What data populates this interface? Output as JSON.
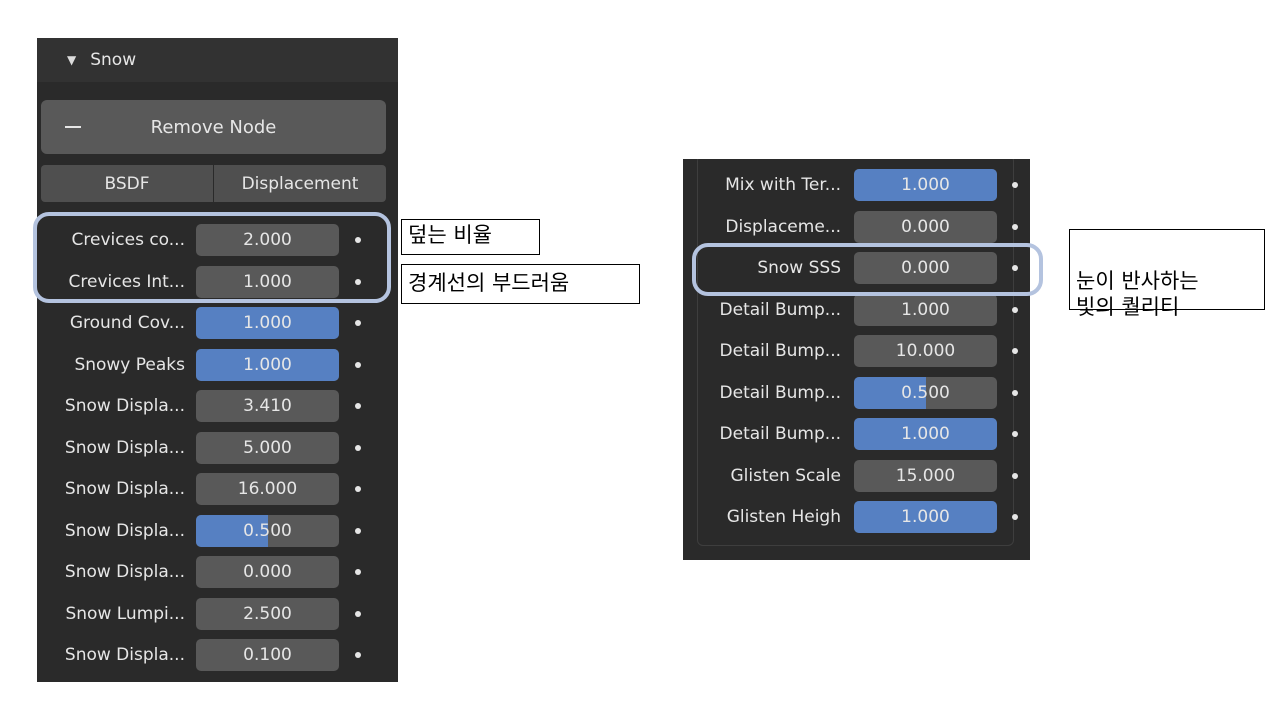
{
  "left_panel": {
    "header": {
      "title": "Snow"
    },
    "remove_button": {
      "label": "Remove Node"
    },
    "tabs": [
      {
        "label": "BSDF"
      },
      {
        "label": "Displacement"
      }
    ],
    "rows": [
      {
        "label": "Crevices co...",
        "value": "2.000",
        "fill": 0
      },
      {
        "label": "Crevices Int...",
        "value": "1.000",
        "fill": 0
      },
      {
        "label": "Ground Cov...",
        "value": "1.000",
        "fill": 1.0
      },
      {
        "label": "Snowy Peaks",
        "value": "1.000",
        "fill": 1.0
      },
      {
        "label": "Snow Displa...",
        "value": "3.410",
        "fill": 0
      },
      {
        "label": "Snow Displa...",
        "value": "5.000",
        "fill": 0
      },
      {
        "label": "Snow Displa...",
        "value": "16.000",
        "fill": 0
      },
      {
        "label": "Snow Displa...",
        "value": "0.500",
        "fill": 0.5
      },
      {
        "label": "Snow Displa...",
        "value": "0.000",
        "fill": 0
      },
      {
        "label": "Snow Lumpi...",
        "value": "2.500",
        "fill": 0
      },
      {
        "label": "Snow Displa...",
        "value": "0.100",
        "fill": 0
      }
    ]
  },
  "right_panel": {
    "rows": [
      {
        "label": "Mix with Ter...",
        "value": "1.000",
        "fill": 1.0
      },
      {
        "label": "Displaceme...",
        "value": "0.000",
        "fill": 0
      },
      {
        "label": "Snow SSS",
        "value": "0.000",
        "fill": 0
      },
      {
        "label": "Detail Bump...",
        "value": "1.000",
        "fill": 0
      },
      {
        "label": "Detail Bump...",
        "value": "10.000",
        "fill": 0
      },
      {
        "label": "Detail Bump...",
        "value": "0.500",
        "fill": 0.5
      },
      {
        "label": "Detail Bump...",
        "value": "1.000",
        "fill": 1.0
      },
      {
        "label": "Glisten Scale",
        "value": "15.000",
        "fill": 0
      },
      {
        "label": "Glisten Heigh",
        "value": "1.000",
        "fill": 1.0
      }
    ]
  },
  "annotations": {
    "crevice_coverage": "덮는 비율",
    "crevice_intensity": "경계선의 부드러움",
    "snow_sss": "눈이 반사하는\n빛의 퀄리티"
  },
  "colors": {
    "panel_bg": "#2a2a2a",
    "field_bg": "#595959",
    "fill_blue": "#5680c2",
    "highlight": "#b4c3df"
  }
}
